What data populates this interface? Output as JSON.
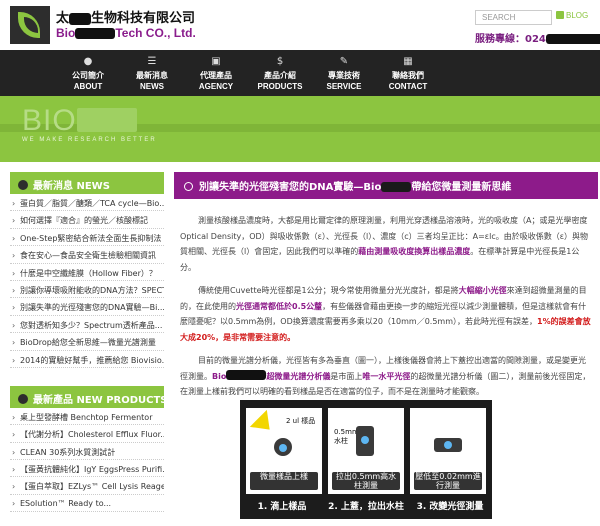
{
  "header": {
    "company_zh_start": "太",
    "company_zh_end": "生物科技有限公司",
    "company_en_start": "Bio",
    "company_en_end": "Tech CO., Ltd.",
    "search_placeholder": "SEARCH",
    "blog_label": "BLOG",
    "hotline_label": "服務專線：024"
  },
  "nav": [
    {
      "zh": "公司簡介",
      "en": "ABOUT",
      "icon": "person-icon"
    },
    {
      "zh": "最新消息",
      "en": "NEWS",
      "icon": "list-icon"
    },
    {
      "zh": "代理產品",
      "en": "AGENCY",
      "icon": "package-icon"
    },
    {
      "zh": "產品介紹",
      "en": "PRODUCTS",
      "icon": "dollar-icon"
    },
    {
      "zh": "專業技術",
      "en": "SERVICE",
      "icon": "wrench-icon"
    },
    {
      "zh": "聯絡我們",
      "en": "CONTACT",
      "icon": "grid-icon"
    }
  ],
  "banner": {
    "title_prefix": "BIO",
    "slogan": "WE MAKE RESEARCH BETTER"
  },
  "sidebar": {
    "news_title": "最新消息 NEWS",
    "news_items": [
      "蛋白質／脂質／醣類／TCA cycle—Bio...",
      "如何選擇『適合』的螢光／核酸標記",
      "One-Step緊密結合新法全面生長抑制法",
      "食在安心—食品安全衛生檢驗相關資訊",
      "什麼是中空纖維膜（Hollow Fiber）？",
      "別讓你導壞吸附能收的DNA方法？SPECT...",
      "別讓失準的光徑殘害您的DNA實驗—Bi...",
      "您對透析知多少？Spectrum透析產品...",
      "BioDrop給您全新思維—微量光譜測量",
      "2014的實驗好幫手，推薦給您 Biovisio..."
    ],
    "products_title": "最新產品 NEW PRODUCTS",
    "product_items": [
      "桌上型發酵槽 Benchtop Fermentor",
      "【代謝分析】Cholesterol Efflux Fluor...",
      "CLEAN 30系列水質測試計",
      "【蛋黃抗體純化】IgY EggsPress Purifi...",
      "【蛋白萃取】EZLys™ Cell Lysis Reage...",
      "ESolution™ Ready to..."
    ]
  },
  "main": {
    "title_start": "別讓失準的光徑殘害您的DNA實驗—Bio",
    "title_end": "帶給您微量測量新思維",
    "p1_a": "測量核酸樣品濃度時，大都是用比爾定律的原理測量，利用光穿透樣品溶液時，光的吸收度（A；或是光學密度 Optical Density，OD）與吸收係數（ε）、光徑長（l）、濃度（c）三者均呈正比：A=εlc。由於吸收係數（ε）與物質相關、光徑長（l）會固定，因此我們可以準確的",
    "p1_hl": "藉由測量吸收度換算出樣品濃度",
    "p1_b": "。在標準計算是中光徑長是1公分。",
    "p2_a": "傳統使用Cuvette時光徑都是1公分；現今常使用微量分光光度計，都是將",
    "p2_hl1": "大幅縮小光徑",
    "p2_b": "來達到超微量測量的目的，在此使用的",
    "p2_hl2": "光徑通常都低於0.5公釐",
    "p2_c": "，有些儀器會藉由更換一步的縮短光徑以減少測量體積，但是這樣就會有什麼隱憂呢？以0.5mm為例，OD換算濃度需要再多乘以20（10mm／0.5mm），若此時光徑有誤差，",
    "p2_red": "1%的誤差會放大成20%，是非常需要注意的。",
    "p3_a": "目前的微量光譜分析儀，光徑皆有多為垂直（圖一），上樣後儀器會將上下蓋控出適當的間隙測量，或是變更光徑測量。",
    "p3_hl1": "Bio",
    "p3_hl2": "超微量光譜分析儀",
    "p3_b": "是市面上",
    "p3_hl3": "唯一水平光徑",
    "p3_c": "的超微量光譜分析儀（圖二），測量前後光徑固定，在測量上樣前我們可以明確的看到樣品是否在適當的位子，而不是在測量時才能觀察。"
  },
  "figure": {
    "panel1_label": "2 ul 樣品",
    "panel1_caption": "微量樣品上樣",
    "panel2_label": "0.5mm 水柱",
    "panel2_caption": "拉出0.5mm高水柱測量",
    "panel3_caption": "壓低至0.02mm進行測量",
    "step1": "1. 滴上樣品",
    "step2": "2. 上蓋，拉出水柱",
    "step3": "3. 改變光徑測量"
  }
}
